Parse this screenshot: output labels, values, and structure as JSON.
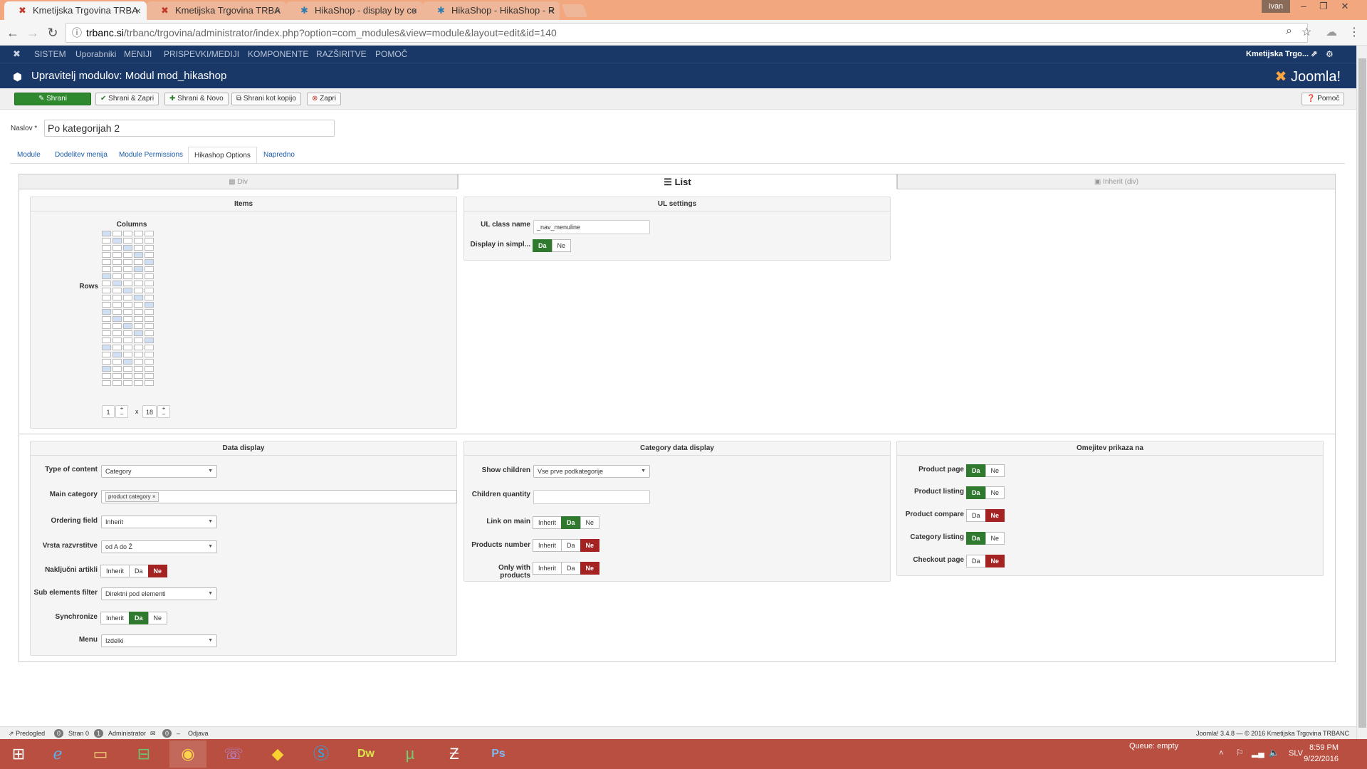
{
  "browser": {
    "tabs": [
      {
        "title": "Kmetijska Trgovina TRBA",
        "active": true
      },
      {
        "title": "Kmetijska Trgovina TRBA",
        "active": false
      },
      {
        "title": "HikaShop - display by co",
        "active": false
      },
      {
        "title": "HikaShop - HikaShop - R",
        "active": false
      }
    ],
    "user": "ivan",
    "url_host": "trbanc.si",
    "url_path": "/trbanc/trgovina/administrator/index.php?option=com_modules&view=module&layout=edit&id=140"
  },
  "joomla_nav": {
    "items": [
      "SISTEM",
      "Uporabniki",
      "MENIJI",
      "PRISPEVKI/MEDIJI",
      "KOMPONENTE",
      "RAZŠIRITVE",
      "POMOČ"
    ],
    "site_name": "Kmetijska Trgo... ⇗"
  },
  "header": {
    "title": "Upravitelj modulov: Modul mod_hikashop",
    "logo": "Joomla!"
  },
  "toolbar": {
    "save": "Shrani",
    "save_close": "Shrani & Zapri",
    "save_new": "Shrani & Novo",
    "save_copy": "Shrani kot kopijo",
    "close": "Zapri",
    "help": "Pomoč"
  },
  "form": {
    "title_label": "Naslov *",
    "title_value": "Po kategorijah 2",
    "tabs": [
      "Module",
      "Dodelitev menija",
      "Module Permissions",
      "Hikashop Options",
      "Napredno"
    ],
    "active_tab": "Hikashop Options"
  },
  "layout_tabs": {
    "div": "Div",
    "list": "List",
    "inherit": "Inherit (div)"
  },
  "items_panel": {
    "title": "Items",
    "columns_label": "Columns",
    "rows_label": "Rows",
    "columns_value": "1",
    "rows_value": "18",
    "times": "x"
  },
  "ul_settings": {
    "title": "UL settings",
    "class_label": "UL class name",
    "class_value": "_nav_menuline",
    "display_label": "Display in simpl...",
    "display_yes": "Da",
    "display_no": "Ne"
  },
  "data_display": {
    "title": "Data display",
    "type_label": "Type of content",
    "type_value": "Category",
    "main_cat_label": "Main category",
    "main_cat_value": "product category",
    "ordering_label": "Ordering field",
    "ordering_value": "Inherit",
    "vrsta_label": "Vrsta razvrstitve",
    "vrsta_value": "od A do Ž",
    "random_label": "Naključni artikli",
    "sub_label": "Sub elements filter",
    "sub_value": "Direktni pod elementi",
    "sync_label": "Synchronize",
    "menu_label": "Menu",
    "menu_value": "Izdelki",
    "inherit": "Inherit",
    "yes": "Da",
    "no": "Ne"
  },
  "category_display": {
    "title": "Category data display",
    "children_label": "Show children",
    "children_value": "Vse prve podkategorije",
    "qty_label": "Children quantity",
    "link_label": "Link on main",
    "products_label": "Products number",
    "only_label": "Only with products"
  },
  "omejitev": {
    "title": "Omejitev prikaza na",
    "rows": [
      {
        "label": "Product page",
        "value": "Da"
      },
      {
        "label": "Product listing",
        "value": "Da"
      },
      {
        "label": "Product compare",
        "value": "Ne"
      },
      {
        "label": "Category listing",
        "value": "Da"
      },
      {
        "label": "Checkout page",
        "value": "Ne"
      }
    ]
  },
  "statusbar": {
    "preview": "Predogled",
    "c1": "0",
    "visitors": "Stran 0",
    "c2": "1",
    "admin": "Administrator",
    "c3": "0",
    "logout": "Odjava",
    "version": "Joomla! 3.4.8 — © 2016 Kmetijska Trgovina TRBANC"
  },
  "taskbar": {
    "queue": "Queue: empty",
    "lang": "SLV",
    "time": "8:59 PM",
    "date": "9/22/2016"
  },
  "colors": {
    "joomla_blue": "#1a3867",
    "green": "#2f7a2f",
    "red": "#a52222",
    "taskbar": "#b94f40"
  }
}
